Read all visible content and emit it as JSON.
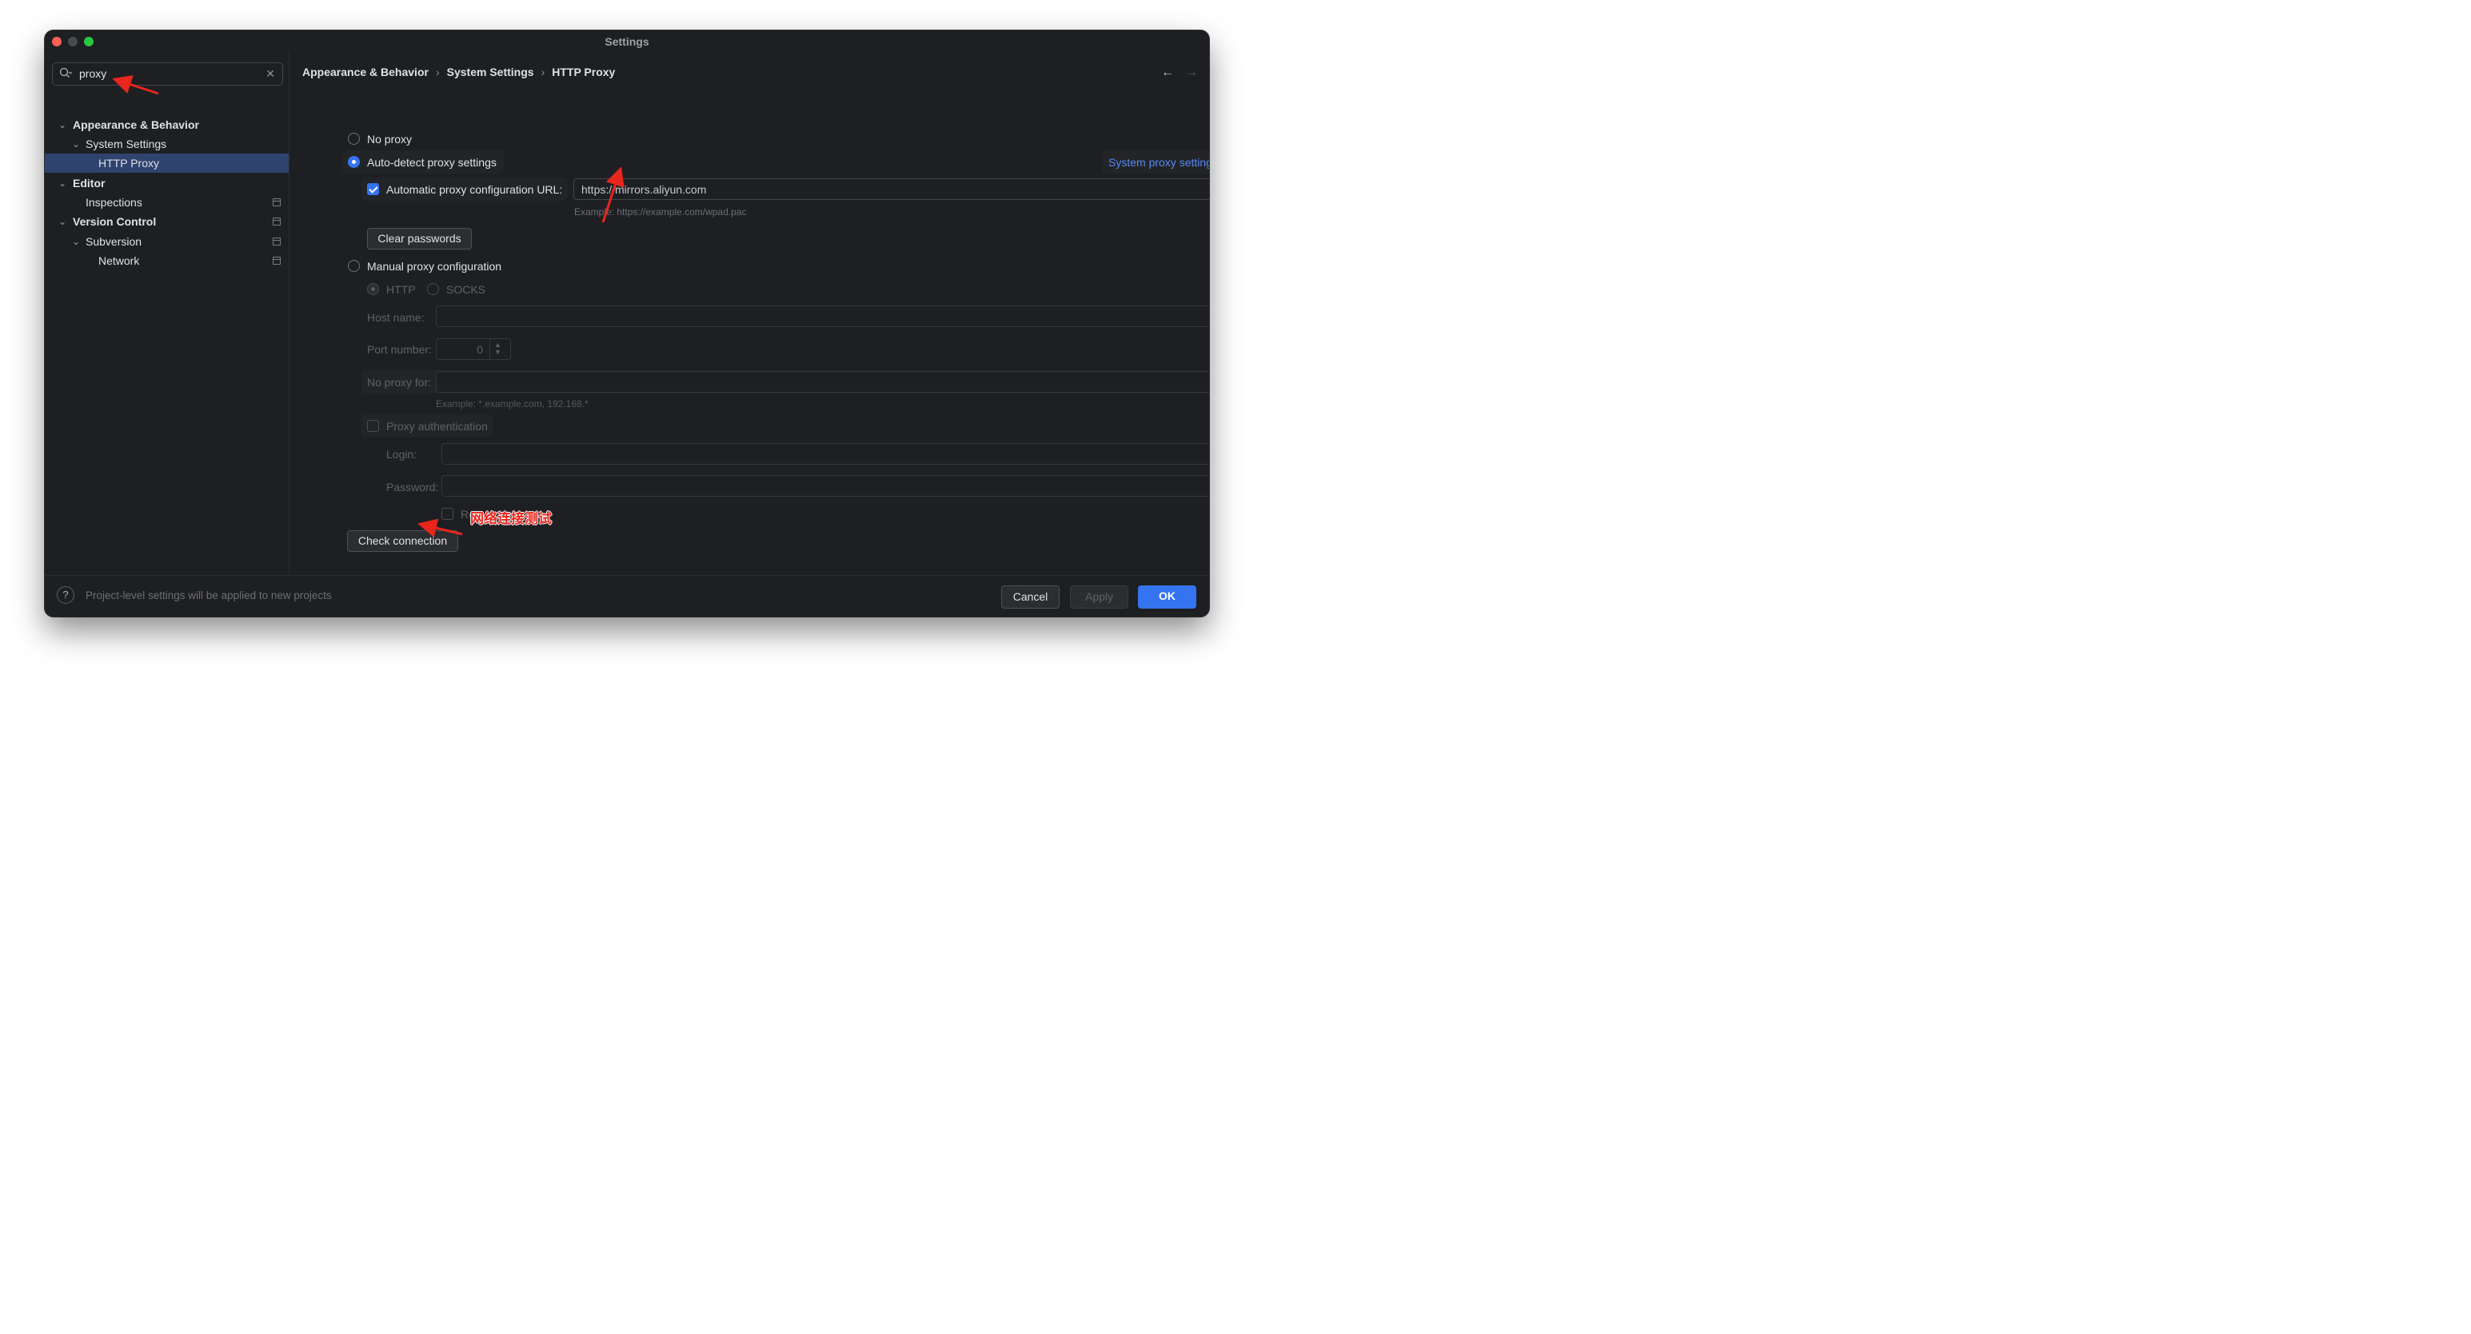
{
  "window": {
    "title": "Settings"
  },
  "search": {
    "value": "proxy",
    "icon": "search-icon",
    "clear_icon": "close-icon"
  },
  "sidebar": {
    "items": [
      {
        "label": "Appearance & Behavior",
        "expanded": true
      },
      {
        "label": "System Settings",
        "expanded": true
      },
      {
        "label": "HTTP Proxy",
        "selected": true
      },
      {
        "label": "Editor",
        "expanded": true
      },
      {
        "label": "Inspections"
      },
      {
        "label": "Version Control",
        "expanded": true
      },
      {
        "label": "Subversion",
        "expanded": true
      },
      {
        "label": "Network"
      }
    ]
  },
  "breadcrumb": [
    "Appearance & Behavior",
    "System Settings",
    "HTTP Proxy"
  ],
  "proxy": {
    "no_proxy": "No proxy",
    "auto_detect": "Auto-detect proxy settings",
    "system_proxy_link": "System proxy settings... ↗",
    "auto_config_label": "Automatic proxy configuration URL:",
    "auto_config_url": "https://mirrors.aliyun.com",
    "auto_config_hint": "Example: https://example.com/wpad.pac",
    "clear_passwords": "Clear passwords",
    "manual": "Manual proxy configuration",
    "http": "HTTP",
    "socks": "SOCKS",
    "host_name_label": "Host name:",
    "port_label": "Port number:",
    "port_value": "0",
    "no_proxy_for_label": "No proxy for:",
    "no_proxy_for_hint": "Example: *.example.com, 192.168.*",
    "proxy_auth": "Proxy authentication",
    "login_label": "Login:",
    "password_label": "Password:",
    "remember": "Remember",
    "check_connection": "Check connection"
  },
  "annotation": {
    "text": "网络连接测试",
    "color": "#e8261d"
  },
  "footer": {
    "note": "Project-level settings will be applied to new projects",
    "help": "?",
    "cancel": "Cancel",
    "apply": "Apply",
    "ok": "OK"
  },
  "colors": {
    "accent": "#3574f0",
    "selection": "#2e436e",
    "background": "#1e1f22",
    "link": "#548af7"
  }
}
